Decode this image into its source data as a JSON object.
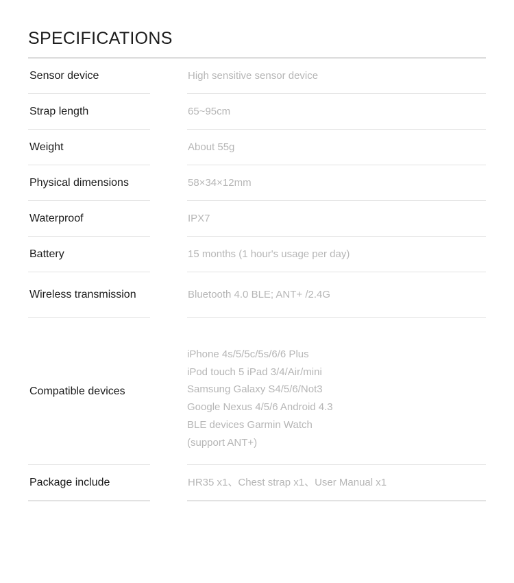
{
  "heading": {
    "title": "SPECIFICATIONS"
  },
  "colors": {
    "label_text": "#1a1a1a",
    "value_text": "#b6b6b6",
    "title_rule": "#9a9a9a",
    "row_divider": "#e2e2e2",
    "background": "#ffffff"
  },
  "rows": [
    {
      "label": "Sensor device",
      "value": "High sensitive sensor device"
    },
    {
      "label": "Strap length",
      "value": "65~95cm"
    },
    {
      "label": "Weight",
      "value": "About 55g"
    },
    {
      "label": "Physical dimensions",
      "value": "58×34×12mm"
    },
    {
      "label": "Waterproof",
      "value": "IPX7"
    },
    {
      "label": "Battery",
      "value": "15 months (1 hour's usage per day)"
    },
    {
      "label_line1": "Wireless",
      "label_line2": "transmission",
      "value": "Bluetooth 4.0 BLE; ANT+ /2.4G"
    },
    {
      "label_line1": "Compatible",
      "label_line2": "devices",
      "value_lines": [
        "iPhone 4s/5/5c/5s/6/6 Plus",
        "iPod touch 5 iPad 3/4/Air/mini",
        "Samsung Galaxy S4/5/6/Not3",
        "Google Nexus 4/5/6 Android 4.3",
        "BLE devices Garmin Watch",
        "(support ANT+)"
      ]
    },
    {
      "label": "Package include",
      "value": "HR35 x1、Chest strap x1、User Manual x1"
    }
  ]
}
